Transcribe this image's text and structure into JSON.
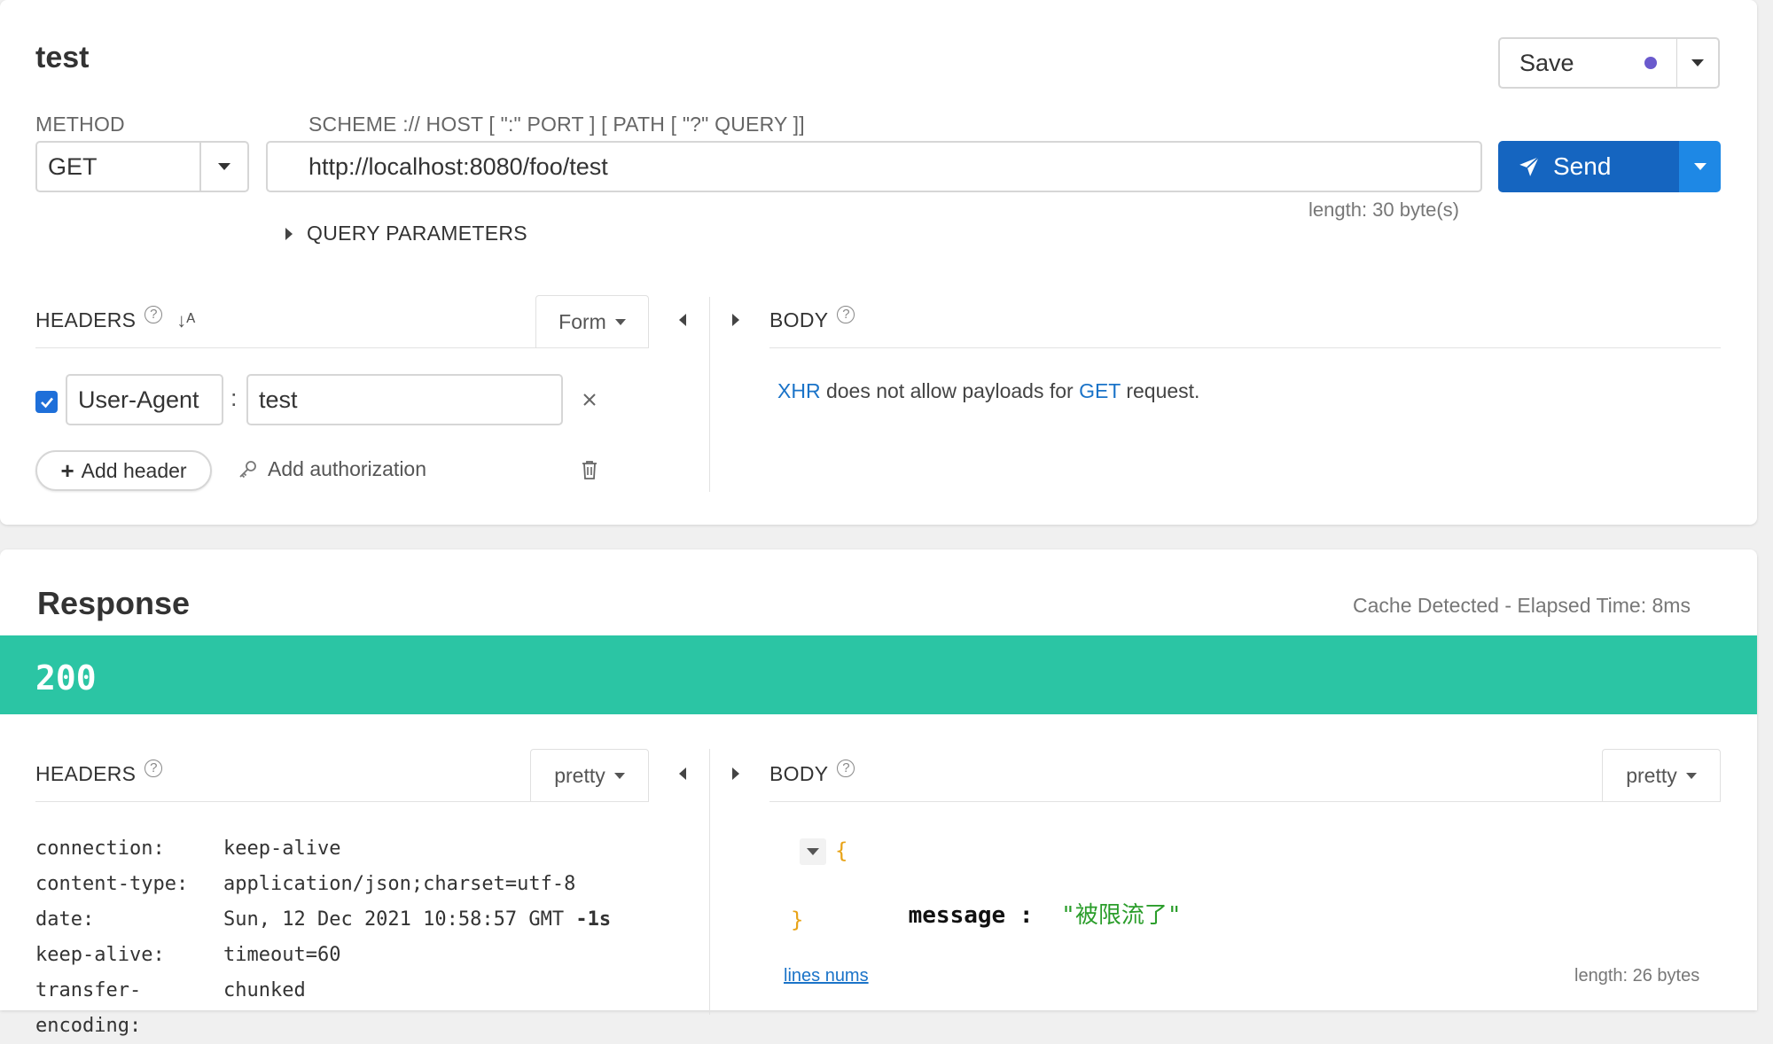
{
  "request": {
    "name": "test",
    "save_label": "Save",
    "method_label": "METHOD",
    "method_value": "GET",
    "url_label": "SCHEME :// HOST [ \":\" PORT ] [ PATH [ \"?\" QUERY ]]",
    "url_value": "http://localhost:8080/foo/test",
    "send_label": "Send",
    "length_text": "length: 30 byte(s)",
    "query_params_label": "QUERY PARAMETERS",
    "headers_label": "HEADERS",
    "sort_icon_text": "↓ᴬ",
    "form_label": "Form",
    "body_label": "BODY",
    "body_note_prefix": "XHR",
    "body_note_middle": " does not allow payloads for ",
    "body_note_method": "GET",
    "body_note_suffix": " request.",
    "header_rows": [
      {
        "name": "User-Agent",
        "value": "test",
        "enabled": true
      }
    ],
    "add_header_label": "Add header",
    "add_authorization_label": "Add authorization"
  },
  "response": {
    "title": "Response",
    "cache_text": "Cache Detected - ",
    "elapsed_text": "Elapsed Time: 8ms",
    "status_code": "200",
    "headers_label": "HEADERS",
    "pretty_label": "pretty",
    "body_label": "BODY",
    "body_pretty_label": "pretty",
    "headers": [
      {
        "key": "connection:",
        "value": "keep-alive",
        "extra": ""
      },
      {
        "key": "content-type:",
        "value": "application/json;charset=utf-8",
        "extra": ""
      },
      {
        "key": "date:",
        "value": "Sun, 12 Dec 2021 10:58:57 GMT",
        "extra": " -1s"
      },
      {
        "key": "keep-alive:",
        "value": "timeout=60",
        "extra": ""
      },
      {
        "key": "transfer-encoding:",
        "value": "chunked",
        "extra": ""
      }
    ],
    "json_open": "{",
    "json_key": "message",
    "json_sep": " : ",
    "json_value": "\"被限流了\"",
    "json_close": "}",
    "lines_nums_label": "lines nums",
    "body_length": "length: 26 bytes"
  },
  "colors": {
    "status_bar": "#2bc5a4",
    "send_button": "#1565c0",
    "send_caret": "#1e88e5",
    "link": "#1a73c8",
    "save_dot": "#6a5acd",
    "json_string": "#2a9d2a",
    "json_brace": "#e8a317"
  }
}
